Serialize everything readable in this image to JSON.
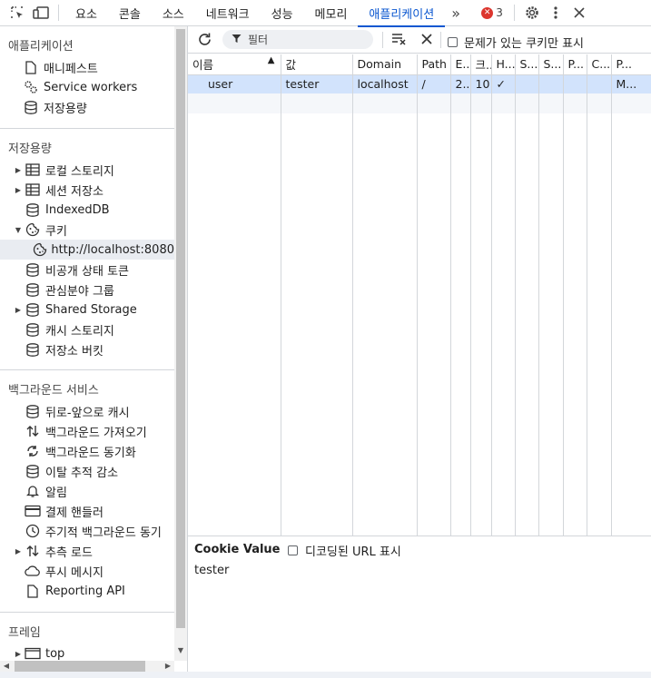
{
  "topbar": {
    "tabs": [
      "요소",
      "콘솔",
      "소스",
      "네트워크",
      "성능",
      "메모리",
      "애플리케이션"
    ],
    "active_tab": "애플리케이션",
    "error_count": "3"
  },
  "sidebar": {
    "sections": [
      {
        "title": "애플리케이션",
        "items": [
          {
            "label": "매니페스트",
            "icon": "document-icon"
          },
          {
            "label": "Service workers",
            "icon": "gears-icon"
          },
          {
            "label": "저장용량",
            "icon": "database-icon"
          }
        ]
      },
      {
        "title": "저장용량",
        "items": [
          {
            "label": "로컬 스토리지",
            "icon": "table-icon"
          },
          {
            "label": "세션 저장소",
            "icon": "table-icon"
          },
          {
            "label": "IndexedDB",
            "icon": "database-icon"
          },
          {
            "label": "쿠키",
            "icon": "cookie-icon"
          },
          {
            "label": "http://localhost:8080",
            "icon": "cookie-icon"
          },
          {
            "label": "비공개 상태 토큰",
            "icon": "database-icon"
          },
          {
            "label": "관심분야 그룹",
            "icon": "database-icon"
          },
          {
            "label": "Shared Storage",
            "icon": "database-icon"
          },
          {
            "label": "캐시 스토리지",
            "icon": "database-icon"
          },
          {
            "label": "저장소 버킷",
            "icon": "database-icon"
          }
        ]
      },
      {
        "title": "백그라운드 서비스",
        "items": [
          {
            "label": "뒤로-앞으로 캐시",
            "icon": "database-icon"
          },
          {
            "label": "백그라운드 가져오기",
            "icon": "fetch-arrows-icon"
          },
          {
            "label": "백그라운드 동기화",
            "icon": "sync-icon"
          },
          {
            "label": "이탈 추적 감소",
            "icon": "database-icon"
          },
          {
            "label": "알림",
            "icon": "bell-icon"
          },
          {
            "label": "결제 핸들러",
            "icon": "card-icon"
          },
          {
            "label": "주기적 백그라운드 동기",
            "icon": "clock-icon"
          },
          {
            "label": "추측 로드",
            "icon": "fetch-arrows-icon"
          },
          {
            "label": "푸시 메시지",
            "icon": "cloud-icon"
          },
          {
            "label": "Reporting API",
            "icon": "document-icon"
          }
        ]
      },
      {
        "title": "프레임",
        "items": [
          {
            "label": "top",
            "icon": "frame-icon"
          }
        ]
      }
    ]
  },
  "toolbar": {
    "filter_placeholder": "필터",
    "only_issues_label": "문제가 있는 쿠키만 표시"
  },
  "table": {
    "headers": [
      "이름",
      "값",
      "Domain",
      "Path",
      "E...",
      "크...",
      "H...",
      "S...",
      "S...",
      "P...",
      "C...",
      "P..."
    ],
    "rows": [
      [
        "user",
        "tester",
        "localhost",
        "/",
        "2...",
        "10",
        "✓",
        "",
        "",
        "",
        "",
        "M..."
      ]
    ]
  },
  "details": {
    "title": "Cookie Value",
    "decode_label": "디코딩된 URL 표시",
    "value": "tester"
  },
  "colors": {
    "accent": "#0b57d0",
    "selected_row": "#d2e3fc",
    "error_red": "#dc362e"
  }
}
